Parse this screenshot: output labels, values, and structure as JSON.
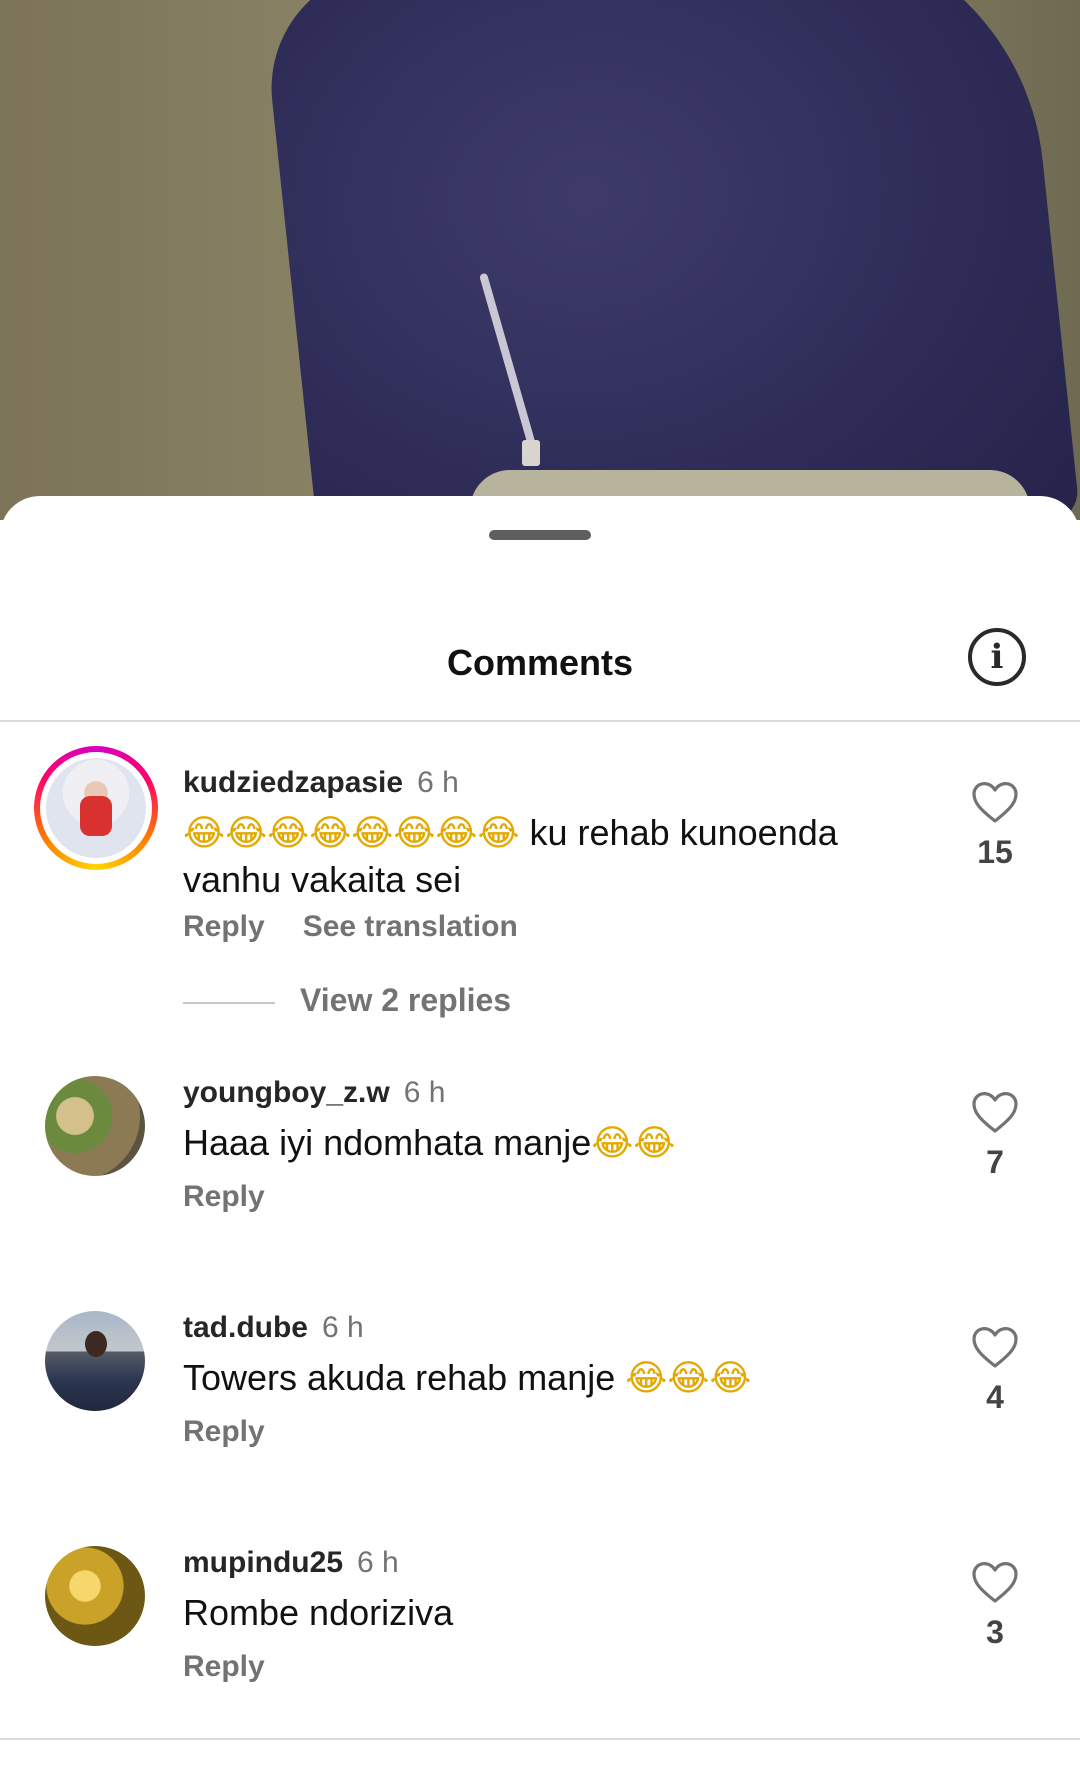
{
  "sheet": {
    "title": "Comments",
    "info_icon": "info-icon"
  },
  "comments": [
    {
      "username": "kudziedzapasie",
      "time": "6 h",
      "emoji": "😂😂😂😂😂😂😂😂",
      "text": " ku rehab kunoenda vanhu vakaita sei",
      "reply": "Reply",
      "translate": "See translation",
      "likes": "15",
      "view_replies": "View 2 replies",
      "has_story_ring": true
    },
    {
      "username": "youngboy_z.w",
      "time": "6 h",
      "text": "Haaa iyi ndomhata manje",
      "emoji": "😂😂",
      "reply": "Reply",
      "likes": "7"
    },
    {
      "username": "tad.dube",
      "time": "6 h",
      "text": "Towers akuda rehab manje ",
      "emoji": "😂😂😂",
      "reply": "Reply",
      "likes": "4"
    },
    {
      "username": "mupindu25",
      "time": "6 h",
      "text": "Rombe ndoriziva",
      "reply": "Reply",
      "likes": "3"
    }
  ]
}
